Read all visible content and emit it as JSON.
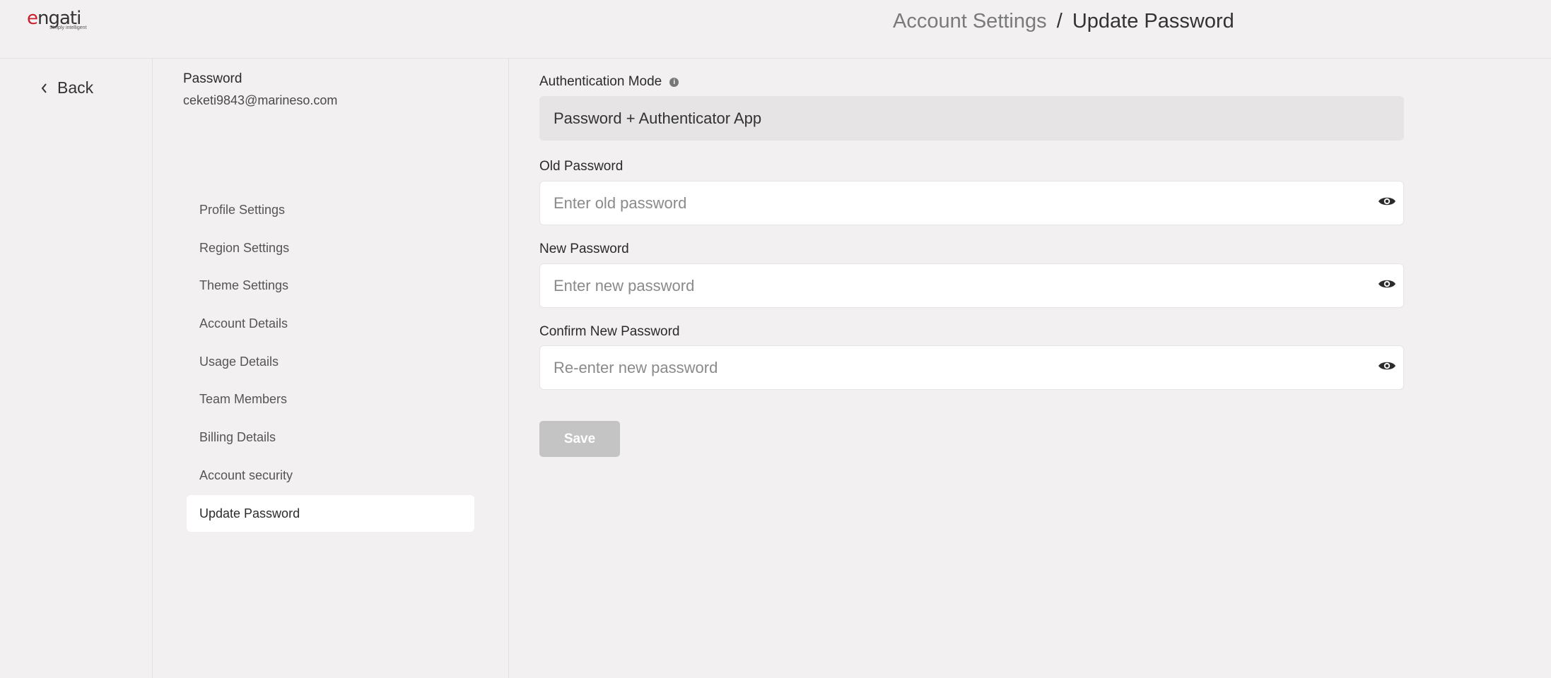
{
  "brand": {
    "logo_text": "engati",
    "tagline": "Simply intelligent"
  },
  "header": {
    "breadcrumb_parent": "Account Settings",
    "breadcrumb_separator": "/",
    "breadcrumb_current": "Update Password"
  },
  "nav": {
    "back_label": "Back"
  },
  "account": {
    "title": "Password",
    "email": "ceketi9843@marineso.com"
  },
  "menu": {
    "items": [
      {
        "label": "Profile Settings"
      },
      {
        "label": "Region Settings"
      },
      {
        "label": "Theme Settings"
      },
      {
        "label": "Account Details"
      },
      {
        "label": "Usage Details"
      },
      {
        "label": "Team Members"
      },
      {
        "label": "Billing Details"
      },
      {
        "label": "Account security"
      },
      {
        "label": "Update Password"
      }
    ],
    "active_index": 8
  },
  "form": {
    "auth_mode_label": "Authentication Mode",
    "auth_mode_value": "Password + Authenticator App",
    "old_password_label": "Old Password",
    "old_password_placeholder": "Enter old password",
    "new_password_label": "New Password",
    "new_password_placeholder": "Enter new password",
    "confirm_password_label": "Confirm New Password",
    "confirm_password_placeholder": "Re-enter new password",
    "save_label": "Save"
  },
  "icons": {
    "back": "chevron-left-icon",
    "info": "info-icon",
    "visibility": "eye-icon"
  },
  "colors": {
    "brand_red": "#c8202f",
    "background": "#f2f0f1",
    "disabled_button": "#c4c4c4"
  }
}
